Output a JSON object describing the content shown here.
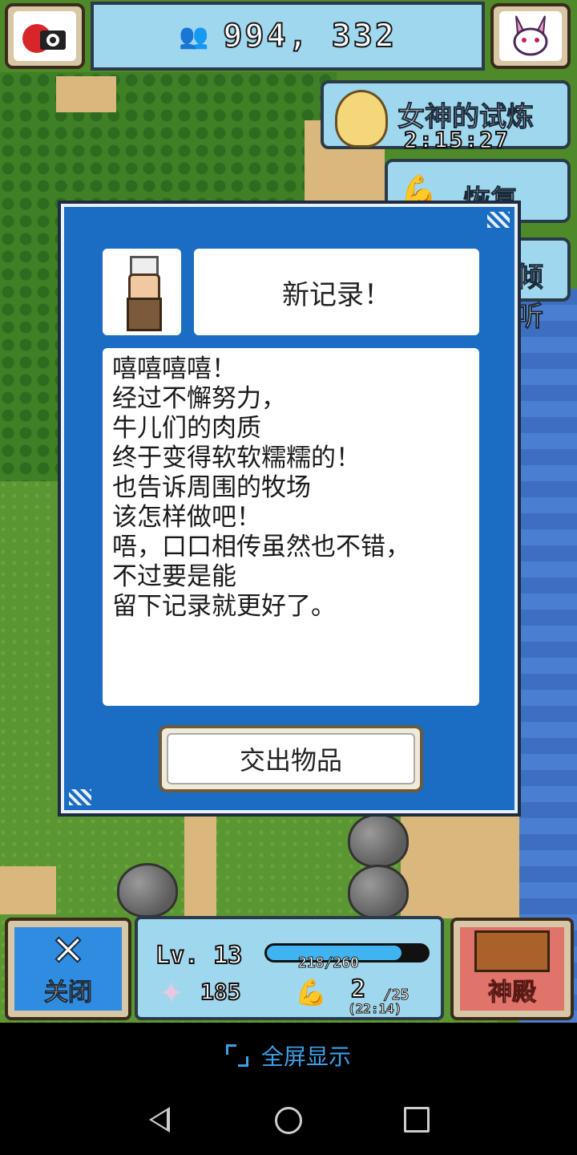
{
  "top_bar": {
    "gold": "994, 332",
    "camera_icon": "camera-icon",
    "mascot_icon": "rabbit-mascot-icon"
  },
  "side_panels": {
    "goddess_trial": {
      "label": "女神的试炼",
      "timer": "2:15:27"
    },
    "recover": {
      "label": "恢复"
    },
    "listen": {
      "label": "倾听"
    }
  },
  "dialog": {
    "title": "新记录！",
    "lines": [
      "嘻嘻嘻嘻！",
      "经过不懈努力，",
      "牛儿们的肉质",
      "终于变得软软糯糯的！",
      "也告诉周围的牧场",
      "该怎样做吧！",
      "唔，口口相传虽然也不错，",
      "不过要是能",
      "留下记录就更好了。"
    ],
    "submit_label": "交出物品"
  },
  "hud": {
    "close_label": "关闭",
    "level": "Lv. 13",
    "xp_text": "218/260",
    "xp_fraction": 0.84,
    "attack": "185",
    "stamina": "2",
    "stamina_max": "/25",
    "stamina_sub": "(22:14)",
    "temple_label": "神殿"
  },
  "system": {
    "fullscreen_label": "全屏显示"
  },
  "colors": {
    "dialog_blue": "#1a6dc2",
    "panel_cyan": "#9fd8ee",
    "fullscreen_blue": "#3da0e8"
  }
}
